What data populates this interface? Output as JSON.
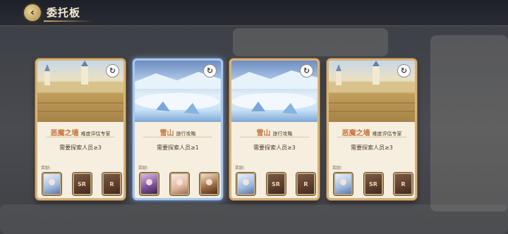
{
  "header": {
    "title": "委托板",
    "back_icon": "back-arrow-icon"
  },
  "colors": {
    "accent_gold": "#d8b27a",
    "accent_blue": "#a9c6ea",
    "name_orange": "#c9763f"
  },
  "cards": [
    {
      "name": "恶魔之墙",
      "subtitle": "难度评估专家",
      "requirement": "需要探索人员≥3",
      "reward_label": "奖励:",
      "theme": "desert",
      "rewards": [
        {
          "type": "char-ice",
          "label": ""
        },
        {
          "type": "sr",
          "label": "SR"
        },
        {
          "type": "r",
          "label": "R"
        }
      ]
    },
    {
      "name": "雪山",
      "subtitle": "旅行攻略",
      "requirement": "需要探索人员≥1",
      "reward_label": "奖励:",
      "theme": "snow",
      "rewards": [
        {
          "type": "char-purple",
          "label": ""
        },
        {
          "type": "char-cream",
          "label": ""
        },
        {
          "type": "char-brown",
          "label": ""
        }
      ]
    },
    {
      "name": "雪山",
      "subtitle": "旅行攻略",
      "requirement": "需要探索人员≥3",
      "reward_label": "奖励:",
      "theme": "snow",
      "rewards": [
        {
          "type": "char-ice",
          "label": ""
        },
        {
          "type": "sr",
          "label": "SR"
        },
        {
          "type": "r",
          "label": "R"
        }
      ]
    },
    {
      "name": "恶魔之墙",
      "subtitle": "难度评估专家",
      "requirement": "需要探索人员≥3",
      "reward_label": "奖励:",
      "theme": "desert",
      "rewards": [
        {
          "type": "char-ice",
          "label": ""
        },
        {
          "type": "sr",
          "label": "SR"
        },
        {
          "type": "r",
          "label": "R"
        }
      ]
    }
  ]
}
